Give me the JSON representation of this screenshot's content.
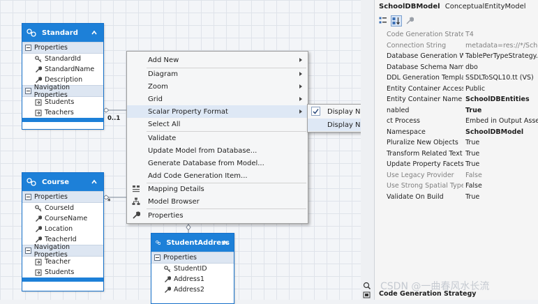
{
  "entities": {
    "standard": {
      "name": "Standard",
      "sections": [
        {
          "title": "Properties",
          "items": [
            {
              "label": "StandardId",
              "kind": "key"
            },
            {
              "label": "StandardName",
              "kind": "prop"
            },
            {
              "label": "Description",
              "kind": "prop"
            }
          ]
        },
        {
          "title": "Navigation Properties",
          "items": [
            {
              "label": "Students",
              "kind": "nav"
            },
            {
              "label": "Teachers",
              "kind": "nav"
            }
          ]
        }
      ]
    },
    "course": {
      "name": "Course",
      "sections": [
        {
          "title": "Properties",
          "items": [
            {
              "label": "CourseId",
              "kind": "key"
            },
            {
              "label": "CourseName",
              "kind": "prop"
            },
            {
              "label": "Location",
              "kind": "prop"
            },
            {
              "label": "TeacherId",
              "kind": "prop"
            }
          ]
        },
        {
          "title": "Navigation Properties",
          "items": [
            {
              "label": "Teacher",
              "kind": "nav"
            },
            {
              "label": "Students",
              "kind": "nav"
            }
          ]
        }
      ]
    },
    "studentaddress": {
      "name": "StudentAddress",
      "sections": [
        {
          "title": "Properties",
          "items": [
            {
              "label": "StudentID",
              "kind": "key"
            },
            {
              "label": "Address1",
              "kind": "prop"
            },
            {
              "label": "Address2",
              "kind": "prop"
            }
          ]
        }
      ]
    }
  },
  "connectors": {
    "standard_mult": "0..1",
    "course_mult": "*"
  },
  "context_menu": {
    "items": [
      {
        "label": "Add New",
        "submenu": true
      },
      {
        "label": "Diagram",
        "submenu": true
      },
      {
        "label": "Zoom",
        "submenu": true
      },
      {
        "label": "Grid",
        "submenu": true
      },
      {
        "label": "Scalar Property Format",
        "submenu": true,
        "highlighted": true
      },
      {
        "label": "Select All",
        "submenu": false
      },
      {
        "label": "Validate",
        "submenu": false
      },
      {
        "label": "Update Model from Database...",
        "submenu": false
      },
      {
        "label": "Generate Database from Model...",
        "submenu": false
      },
      {
        "label": "Add Code Generation Item...",
        "submenu": false
      },
      {
        "label": "Mapping Details",
        "submenu": false,
        "icon": "mapping-details-icon"
      },
      {
        "label": "Model Browser",
        "submenu": false,
        "icon": "model-browser-icon"
      },
      {
        "label": "Properties",
        "submenu": false,
        "icon": "wrench-icon"
      }
    ]
  },
  "submenu": {
    "items": [
      {
        "label": "Display Name",
        "checked": true
      },
      {
        "label": "Display Name and Type",
        "checked": false,
        "highlighted": true
      }
    ]
  },
  "properties_panel": {
    "object_name": "SchoolDBModel",
    "object_type": "ConceptualEntityModel",
    "rows": [
      {
        "key": "Code Generation Strategy",
        "value": "T4",
        "state": "disabled"
      },
      {
        "key": "Connection String",
        "value": "metadata=res://*/Schoo",
        "state": "disabled"
      },
      {
        "key": "Database Generation Wor",
        "value": "TablePerTypeStrategy.xa",
        "state": "normal"
      },
      {
        "key": "Database Schema Name",
        "value": "dbo",
        "state": "normal"
      },
      {
        "key": "DDL Generation Template",
        "value": "SSDLToSQL10.tt (VS)",
        "state": "normal"
      },
      {
        "key": "Entity Container Access",
        "value": "Public",
        "state": "normal"
      },
      {
        "key": "Entity Container Name",
        "value": "SchoolDBEntities",
        "state": "normal",
        "bold": true
      },
      {
        "key": "nabled",
        "value": "True",
        "state": "normal",
        "bold": true
      },
      {
        "key": "ct Process",
        "value": "Embed in Output Assem",
        "state": "normal"
      },
      {
        "key": "Namespace",
        "value": "SchoolDBModel",
        "state": "normal",
        "bold": true
      },
      {
        "key": "Pluralize New Objects",
        "value": "True",
        "state": "normal"
      },
      {
        "key": "Transform Related Text T",
        "value": "True",
        "state": "normal"
      },
      {
        "key": "Update Property Facets",
        "value": "True",
        "state": "normal"
      },
      {
        "key": "Use Legacy Provider",
        "value": "False",
        "state": "disabled"
      },
      {
        "key": "Use Strong Spatial Types",
        "value": "False",
        "state": "disabled",
        "value_normal": true
      },
      {
        "key": "Validate On Build",
        "value": "True",
        "state": "normal"
      }
    ],
    "description_title": "Code Generation Strategy"
  },
  "watermark": "CSDN @一曲春风水长流",
  "colors": {
    "entity_header": "#1d80d8",
    "menu_highlight": "#dee8f5"
  }
}
